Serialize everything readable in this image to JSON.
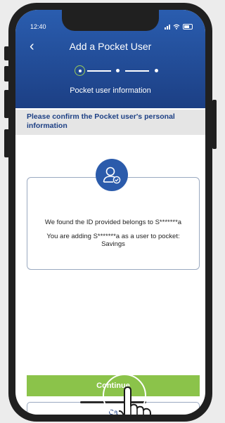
{
  "status_bar": {
    "time": "12:40"
  },
  "header": {
    "title": "Add a Pocket User",
    "subtitle": "Pocket user information"
  },
  "confirm": {
    "text": "Please confirm the Pocket user's personal information"
  },
  "card": {
    "found_text": "We found the ID provided belongs to S*******a",
    "adding_text": "You are adding S*******a as a user to pocket: Savings"
  },
  "buttons": {
    "continue_label": "Continue",
    "cancel_label": "Ca"
  },
  "colors": {
    "header": "#1c3f84",
    "accent": "#8bc34a",
    "avatar": "#2b5bab"
  },
  "icons": [
    "back-arrow-icon",
    "signal-icon",
    "wifi-icon",
    "battery-icon",
    "user-check-icon",
    "tap-hand-icon"
  ]
}
